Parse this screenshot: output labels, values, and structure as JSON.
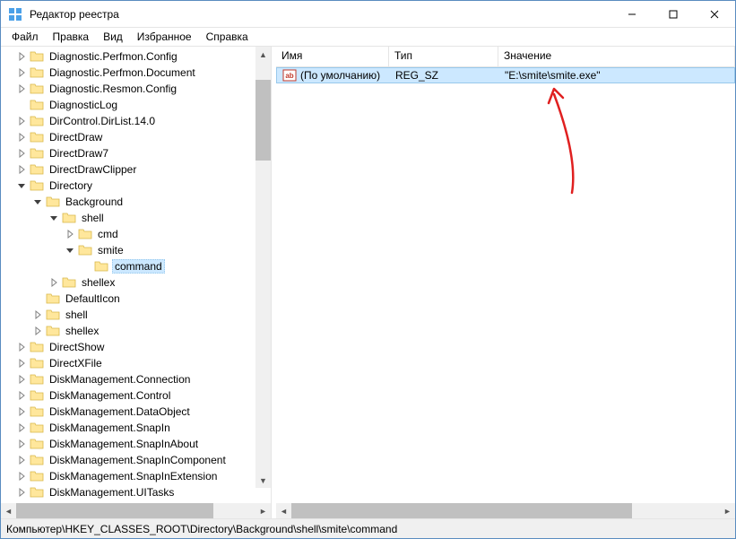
{
  "window": {
    "title": "Редактор реестра"
  },
  "menu": {
    "file": "Файл",
    "edit": "Правка",
    "view": "Вид",
    "favorites": "Избранное",
    "help": "Справка"
  },
  "tree": {
    "items": [
      {
        "label": "Diagnostic.Perfmon.Config",
        "depth": 0,
        "expander": ">"
      },
      {
        "label": "Diagnostic.Perfmon.Document",
        "depth": 0,
        "expander": ">"
      },
      {
        "label": "Diagnostic.Resmon.Config",
        "depth": 0,
        "expander": ">"
      },
      {
        "label": "DiagnosticLog",
        "depth": 0,
        "expander": ""
      },
      {
        "label": "DirControl.DirList.14.0",
        "depth": 0,
        "expander": ">"
      },
      {
        "label": "DirectDraw",
        "depth": 0,
        "expander": ">"
      },
      {
        "label": "DirectDraw7",
        "depth": 0,
        "expander": ">"
      },
      {
        "label": "DirectDrawClipper",
        "depth": 0,
        "expander": ">"
      },
      {
        "label": "Directory",
        "depth": 0,
        "expander": "v"
      },
      {
        "label": "Background",
        "depth": 1,
        "expander": "v"
      },
      {
        "label": "shell",
        "depth": 2,
        "expander": "v"
      },
      {
        "label": "cmd",
        "depth": 3,
        "expander": ">"
      },
      {
        "label": "smite",
        "depth": 3,
        "expander": "v"
      },
      {
        "label": "command",
        "depth": 4,
        "expander": "",
        "selected": true
      },
      {
        "label": "shellex",
        "depth": 2,
        "expander": ">"
      },
      {
        "label": "DefaultIcon",
        "depth": 1,
        "expander": ""
      },
      {
        "label": "shell",
        "depth": 1,
        "expander": ">"
      },
      {
        "label": "shellex",
        "depth": 1,
        "expander": ">"
      },
      {
        "label": "DirectShow",
        "depth": 0,
        "expander": ">"
      },
      {
        "label": "DirectXFile",
        "depth": 0,
        "expander": ">"
      },
      {
        "label": "DiskManagement.Connection",
        "depth": 0,
        "expander": ">"
      },
      {
        "label": "DiskManagement.Control",
        "depth": 0,
        "expander": ">"
      },
      {
        "label": "DiskManagement.DataObject",
        "depth": 0,
        "expander": ">"
      },
      {
        "label": "DiskManagement.SnapIn",
        "depth": 0,
        "expander": ">"
      },
      {
        "label": "DiskManagement.SnapInAbout",
        "depth": 0,
        "expander": ">"
      },
      {
        "label": "DiskManagement.SnapInComponent",
        "depth": 0,
        "expander": ">"
      },
      {
        "label": "DiskManagement.SnapInExtension",
        "depth": 0,
        "expander": ">"
      },
      {
        "label": "DiskManagement.UITasks",
        "depth": 0,
        "expander": ">"
      }
    ]
  },
  "list": {
    "head": {
      "name": "Имя",
      "type": "Тип",
      "value": "Значение"
    },
    "rows": [
      {
        "name": "(По умолчанию)",
        "type": "REG_SZ",
        "value": "\"E:\\smite\\smite.exe\"",
        "selected": true
      }
    ]
  },
  "status": {
    "path": "Компьютер\\HKEY_CLASSES_ROOT\\Directory\\Background\\shell\\smite\\command"
  }
}
